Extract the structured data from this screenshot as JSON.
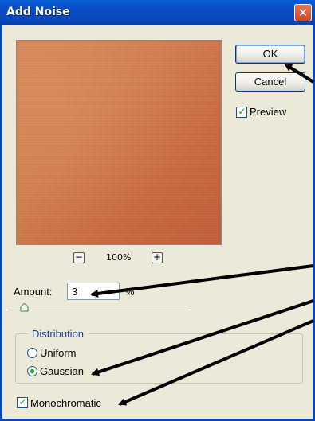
{
  "window": {
    "title": "Add Noise",
    "close_glyph": "✕"
  },
  "preview": {
    "zoom_out_glyph": "−",
    "zoom_in_glyph": "+",
    "zoom_level": "100%"
  },
  "buttons": {
    "ok_label": "OK",
    "cancel_label": "Cancel"
  },
  "preview_toggle": {
    "label": "Preview",
    "checked": true
  },
  "amount": {
    "label": "Amount:",
    "value": "3",
    "unit": "%"
  },
  "distribution": {
    "title": "Distribution",
    "options": [
      {
        "label": "Uniform",
        "selected": false
      },
      {
        "label": "Gaussian",
        "selected": true
      }
    ]
  },
  "monochromatic": {
    "label": "Monochromatic",
    "checked": true
  },
  "colors": {
    "title_bar": "#0847b8",
    "dialog_bg": "#ece9d8",
    "preview_fill": "#d07a4c",
    "check_green": "#21a121",
    "group_title": "#1c3f9f"
  }
}
